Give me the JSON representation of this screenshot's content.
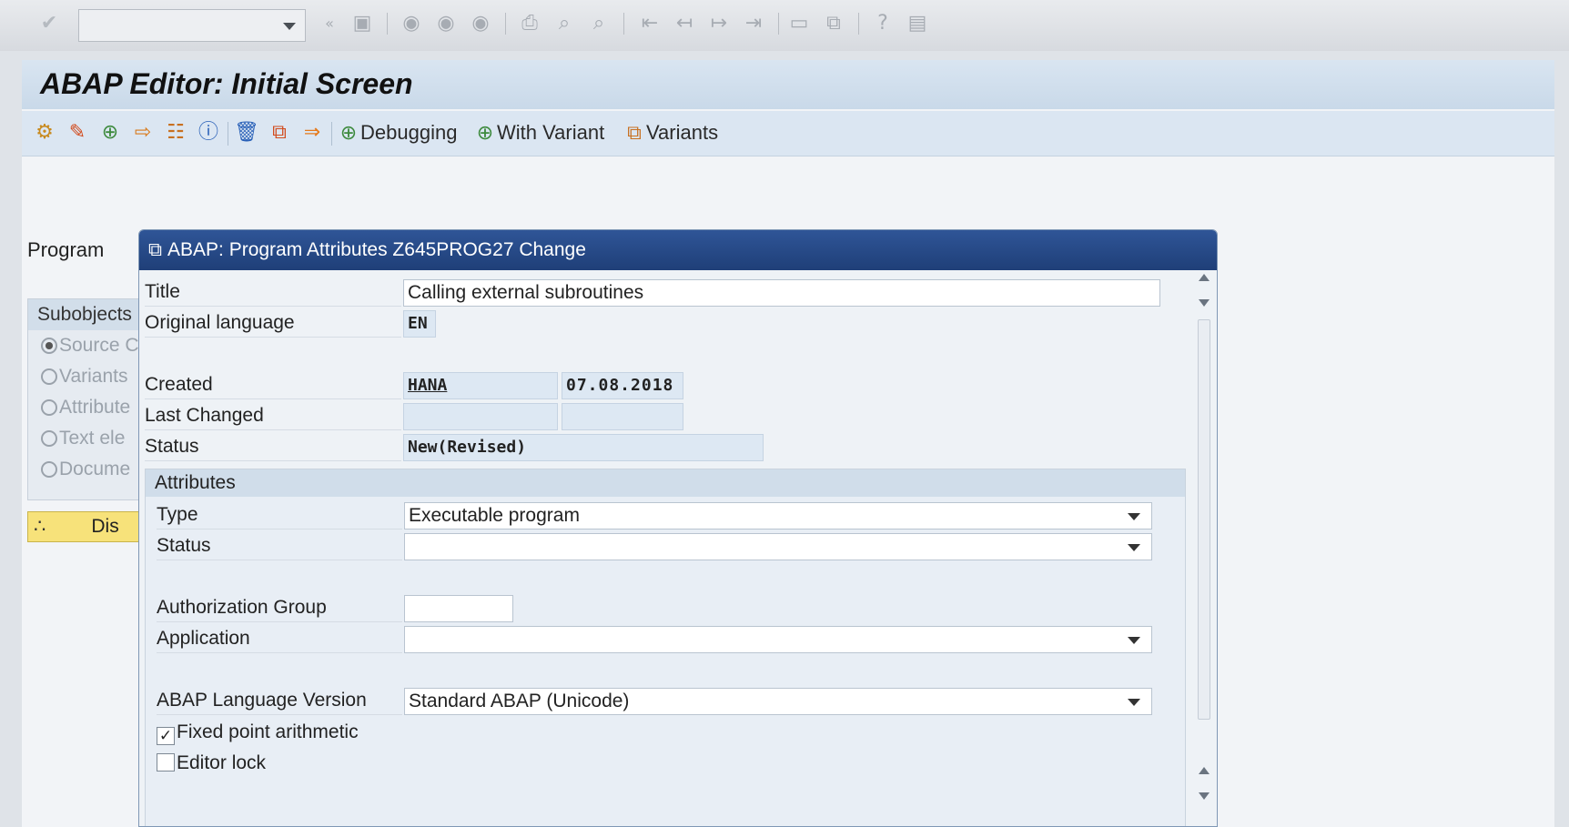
{
  "system_toolbar": {
    "icons": [
      "enter-icon",
      "save-icon",
      "back-icon",
      "exit-icon",
      "cancel-icon",
      "print-icon",
      "find-icon",
      "find-next-icon",
      "first-page-icon",
      "previous-page-icon",
      "next-page-icon",
      "last-page-icon",
      "new-session-icon",
      "shortcut-icon",
      "help-icon",
      "customize-layout-icon"
    ]
  },
  "window": {
    "title": "ABAP Editor: Initial Screen"
  },
  "app_toolbar": {
    "debugging_label": "Debugging",
    "with_variant_label": "With Variant",
    "variants_label": "Variants"
  },
  "background": {
    "program_label": "Program",
    "subobjects_header": "Subobjects",
    "subobjects": [
      "Source C",
      "Variants",
      "Attribute",
      "Text ele",
      "Docume"
    ],
    "display_label": "Dis"
  },
  "dialog": {
    "title": "ABAP: Program Attributes Z645PROG27 Change",
    "title_label": "Title",
    "title_value": "Calling external subroutines",
    "original_language_label": "Original language",
    "original_language_value": "EN",
    "created_label": "Created",
    "created_by": "HANA",
    "created_on": "07.08.2018",
    "last_changed_label": "Last Changed",
    "last_changed_by": "",
    "last_changed_on": "",
    "status_label": "Status",
    "status_value": "New(Revised)",
    "attributes": {
      "header": "Attributes",
      "type_label": "Type",
      "type_value": "Executable program",
      "status_label": "Status",
      "status_value": "",
      "auth_group_label": "Authorization Group",
      "auth_group_value": "",
      "application_label": "Application",
      "application_value": "",
      "abap_version_label": "ABAP Language Version",
      "abap_version_value": "Standard ABAP (Unicode)",
      "fixed_point_label": "Fixed point arithmetic",
      "fixed_point_checked": true,
      "editor_lock_label": "Editor lock",
      "editor_lock_checked": false
    }
  }
}
